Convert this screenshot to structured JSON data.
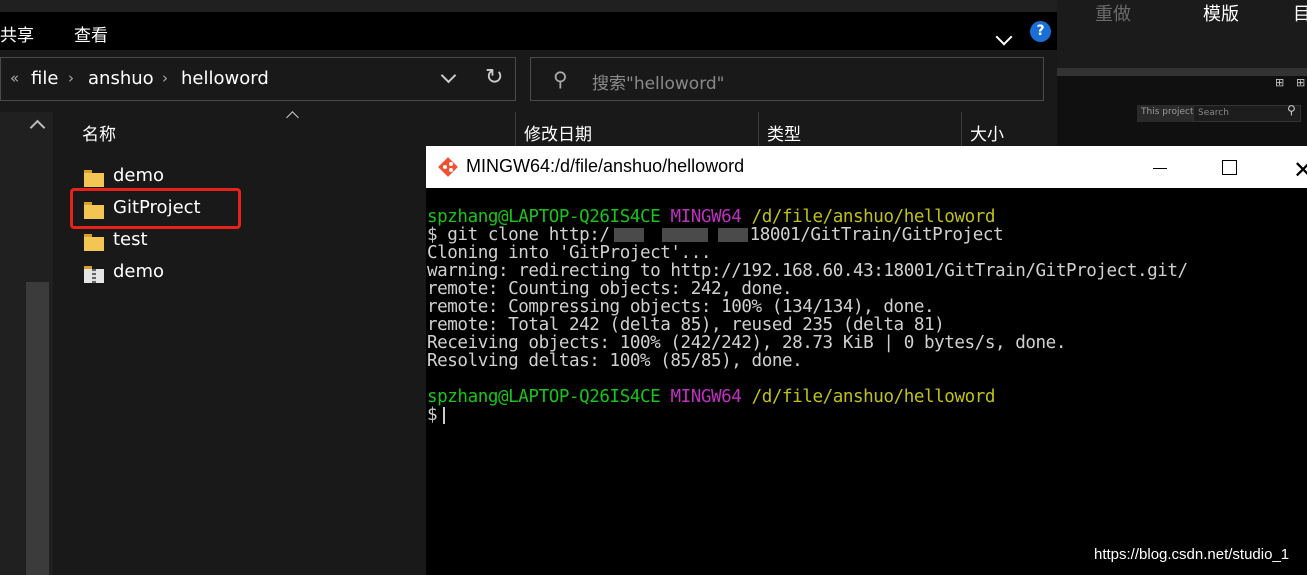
{
  "explorer": {
    "ribbon_tabs": [
      "共享",
      "查看"
    ],
    "help_label": "?",
    "breadcrumb": [
      "file",
      "anshuo",
      "helloword"
    ],
    "breadcrumb_back": "«",
    "search_placeholder": "搜索\"helloword\"",
    "columns": [
      "名称",
      "修改日期",
      "类型",
      "大小"
    ],
    "files": [
      {
        "name": "demo",
        "icon": "folder-icon"
      },
      {
        "name": "GitProject",
        "icon": "folder-icon"
      },
      {
        "name": "test",
        "icon": "folder-icon"
      },
      {
        "name": "demo",
        "icon": "zip-folder-icon"
      }
    ]
  },
  "background_app": {
    "menu": [
      "重做",
      "模版",
      "目"
    ],
    "project_label": "This project",
    "search_placeholder": "Search"
  },
  "terminal": {
    "title": "MINGW64:/d/file/anshuo/helloword",
    "prompt": {
      "user": "spzhang@LAPTOP-Q26IS4CE",
      "env": "MINGW64",
      "path": "/d/file/anshuo/helloword"
    },
    "command_prefix": "$ git clone http:/",
    "command_suffix": "18001/GitTrain/GitProject",
    "output": [
      "Cloning into 'GitProject'...",
      "warning: redirecting to http://192.168.60.43:18001/GitTrain/GitProject.git/",
      "remote: Counting objects: 242, done.",
      "remote: Compressing objects: 100% (134/134), done.",
      "remote: Total 242 (delta 85), reused 235 (delta 81)",
      "Receiving objects: 100% (242/242), 28.73 KiB | 0 bytes/s, done.",
      "Resolving deltas: 100% (85/85), done."
    ],
    "final_prompt_symbol": "$"
  },
  "watermark": "https://blog.csdn.net/studio_1",
  "colors": {
    "highlight": "#e5231b",
    "prompt_user": "#17c417",
    "prompt_env": "#c030c0",
    "prompt_path": "#c0c018"
  }
}
